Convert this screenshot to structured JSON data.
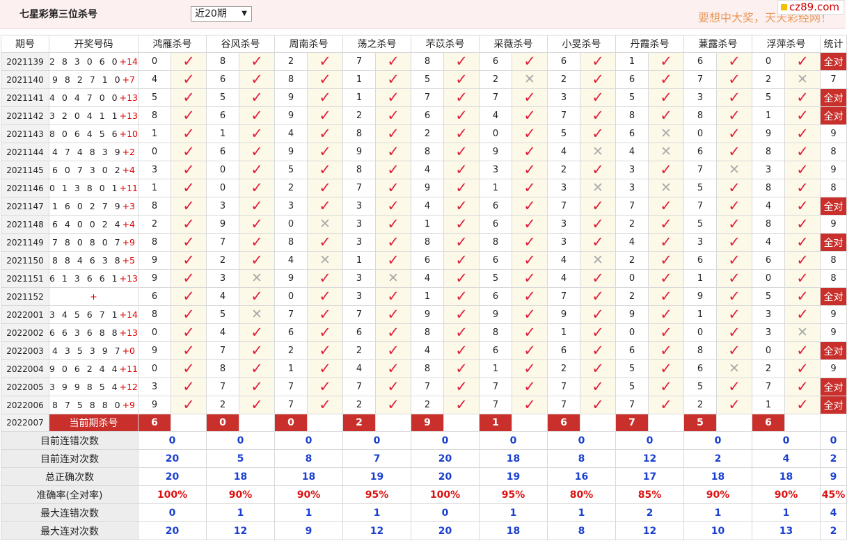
{
  "header": {
    "title": "七星彩第三位杀号",
    "period_select": "近20期",
    "slogan": "要想中大奖，天天彩经网！",
    "logo": "cz89.com"
  },
  "columns": {
    "period": "期号",
    "draw": "开奖号码",
    "experts": [
      "鸿雁杀号",
      "谷风杀号",
      "周南杀号",
      "荡之杀号",
      "芣苡杀号",
      "采薇杀号",
      "小旻杀号",
      "丹霞杀号",
      "蒹露杀号",
      "浮萍杀号"
    ],
    "stat": "统计"
  },
  "rows": [
    {
      "period": "2021139",
      "nums": "2 8 3 0 6 0",
      "sum": "+14",
      "kills": [
        "0",
        "8",
        "2",
        "7",
        "8",
        "6",
        "6",
        "1",
        "6",
        "0"
      ],
      "res": "1111111111",
      "stat": "全对"
    },
    {
      "period": "2021140",
      "nums": "9 8 2 7 1 0",
      "sum": "+7",
      "kills": [
        "4",
        "6",
        "8",
        "1",
        "5",
        "2",
        "2",
        "6",
        "7",
        "2"
      ],
      "res": "1111101110",
      "stat": "7"
    },
    {
      "period": "2021141",
      "nums": "4 0 4 7 0 0",
      "sum": "+13",
      "kills": [
        "5",
        "5",
        "9",
        "1",
        "7",
        "7",
        "3",
        "5",
        "3",
        "5"
      ],
      "res": "1111111111",
      "stat": "全对"
    },
    {
      "period": "2021142",
      "nums": "3 2 0 4 1 1",
      "sum": "+13",
      "kills": [
        "8",
        "6",
        "9",
        "2",
        "6",
        "4",
        "7",
        "8",
        "8",
        "1"
      ],
      "res": "1111111111",
      "stat": "全对"
    },
    {
      "period": "2021143",
      "nums": "8 0 6 4 5 6",
      "sum": "+10",
      "kills": [
        "1",
        "1",
        "4",
        "8",
        "2",
        "0",
        "5",
        "6",
        "0",
        "9"
      ],
      "res": "1111111011",
      "stat": "9"
    },
    {
      "period": "2021144",
      "nums": "4 7 4 8 3 9",
      "sum": "+2",
      "kills": [
        "0",
        "6",
        "9",
        "9",
        "8",
        "9",
        "4",
        "4",
        "6",
        "8"
      ],
      "res": "1111110011",
      "stat": "8"
    },
    {
      "period": "2021145",
      "nums": "6 0 7 3 0 2",
      "sum": "+4",
      "kills": [
        "3",
        "0",
        "5",
        "8",
        "4",
        "3",
        "2",
        "3",
        "7",
        "3"
      ],
      "res": "1111111101",
      "stat": "9"
    },
    {
      "period": "2021146",
      "nums": "0 1 3 8 0 1",
      "sum": "+11",
      "kills": [
        "1",
        "0",
        "2",
        "7",
        "9",
        "1",
        "3",
        "3",
        "5",
        "8"
      ],
      "res": "1111110011",
      "stat": "8"
    },
    {
      "period": "2021147",
      "nums": "1 6 0 2 7 9",
      "sum": "+3",
      "kills": [
        "8",
        "3",
        "3",
        "3",
        "4",
        "6",
        "7",
        "7",
        "7",
        "4"
      ],
      "res": "1111111111",
      "stat": "全对"
    },
    {
      "period": "2021148",
      "nums": "6 4 0 0 2 4",
      "sum": "+4",
      "kills": [
        "2",
        "9",
        "0",
        "3",
        "1",
        "6",
        "3",
        "2",
        "5",
        "8"
      ],
      "res": "1101111111",
      "stat": "9"
    },
    {
      "period": "2021149",
      "nums": "7 8 0 8 0 7",
      "sum": "+9",
      "kills": [
        "8",
        "7",
        "8",
        "3",
        "8",
        "8",
        "3",
        "4",
        "3",
        "4"
      ],
      "res": "1111111111",
      "stat": "全对"
    },
    {
      "period": "2021150",
      "nums": "8 8 4 6 3 8",
      "sum": "+5",
      "kills": [
        "9",
        "2",
        "4",
        "1",
        "6",
        "6",
        "4",
        "2",
        "6",
        "6"
      ],
      "res": "1101110111",
      "stat": "8"
    },
    {
      "period": "2021151",
      "nums": "6 1 3 6 6 1",
      "sum": "+13",
      "kills": [
        "9",
        "3",
        "9",
        "3",
        "4",
        "5",
        "4",
        "0",
        "1",
        "0"
      ],
      "res": "1010111111",
      "stat": "8"
    },
    {
      "period": "2021152",
      "nums": "",
      "sum": "+",
      "kills": [
        "6",
        "4",
        "0",
        "3",
        "1",
        "6",
        "7",
        "2",
        "9",
        "5"
      ],
      "res": "1111111111",
      "stat": "全对"
    },
    {
      "period": "2022001",
      "nums": "3 4 5 6 7 1",
      "sum": "+14",
      "kills": [
        "8",
        "5",
        "7",
        "7",
        "9",
        "9",
        "9",
        "9",
        "1",
        "3"
      ],
      "res": "1011111111",
      "stat": "9"
    },
    {
      "period": "2022002",
      "nums": "6 6 3 6 8 8",
      "sum": "+13",
      "kills": [
        "0",
        "4",
        "6",
        "6",
        "8",
        "8",
        "1",
        "0",
        "0",
        "3"
      ],
      "res": "1111111110",
      "stat": "9"
    },
    {
      "period": "2022003",
      "nums": "4 3 5 3 9 7",
      "sum": "+0",
      "kills": [
        "9",
        "7",
        "2",
        "2",
        "4",
        "6",
        "6",
        "6",
        "8",
        "0"
      ],
      "res": "1111111111",
      "stat": "全对"
    },
    {
      "period": "2022004",
      "nums": "9 0 6 2 4 4",
      "sum": "+11",
      "kills": [
        "0",
        "8",
        "1",
        "4",
        "8",
        "1",
        "2",
        "5",
        "6",
        "2"
      ],
      "res": "1111111101",
      "stat": "9"
    },
    {
      "period": "2022005",
      "nums": "3 9 9 8 5 4",
      "sum": "+12",
      "kills": [
        "3",
        "7",
        "7",
        "7",
        "7",
        "7",
        "7",
        "5",
        "5",
        "7"
      ],
      "res": "1111111111",
      "stat": "全对"
    },
    {
      "period": "2022006",
      "nums": "8 7 5 8 8 0",
      "sum": "+9",
      "kills": [
        "9",
        "2",
        "7",
        "2",
        "2",
        "7",
        "7",
        "7",
        "2",
        "1"
      ],
      "res": "1111111111",
      "stat": "全对"
    }
  ],
  "current": {
    "period": "2022007",
    "label": "当前期杀号",
    "kills": [
      "6",
      "0",
      "0",
      "2",
      "9",
      "1",
      "6",
      "7",
      "5",
      "6"
    ]
  },
  "summary": [
    {
      "label": "目前连错次数",
      "values": [
        "0",
        "0",
        "0",
        "0",
        "0",
        "0",
        "0",
        "0",
        "0",
        "0"
      ],
      "stat": "0"
    },
    {
      "label": "目前连对次数",
      "values": [
        "20",
        "5",
        "8",
        "7",
        "20",
        "18",
        "8",
        "12",
        "2",
        "4"
      ],
      "stat": "2"
    },
    {
      "label": "总正确次数",
      "values": [
        "20",
        "18",
        "18",
        "19",
        "20",
        "19",
        "16",
        "17",
        "18",
        "18"
      ],
      "stat": "9"
    },
    {
      "label": "准确率(全对率)",
      "values": [
        "100%",
        "90%",
        "90%",
        "95%",
        "100%",
        "95%",
        "80%",
        "85%",
        "90%",
        "90%"
      ],
      "stat": "45%",
      "rate": true
    },
    {
      "label": "最大连错次数",
      "values": [
        "0",
        "1",
        "1",
        "1",
        "0",
        "1",
        "1",
        "2",
        "1",
        "1"
      ],
      "stat": "4"
    },
    {
      "label": "最大连对次数",
      "values": [
        "20",
        "12",
        "9",
        "12",
        "20",
        "18",
        "8",
        "12",
        "10",
        "13"
      ],
      "stat": "2"
    }
  ],
  "icons": {
    "correct": "check-icon",
    "wrong": "cross-icon"
  },
  "colors": {
    "accent": "#c9302c",
    "correct": "#e0203a",
    "wrong": "#aaaaaa",
    "stat_blue": "#1a3fd0"
  }
}
